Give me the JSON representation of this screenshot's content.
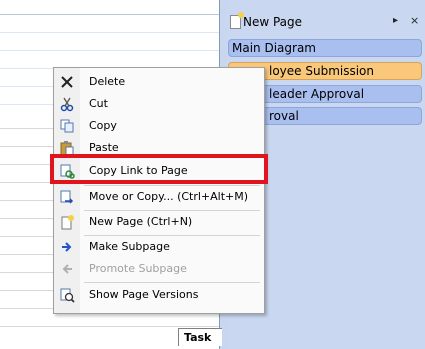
{
  "pages_pane": {
    "new_page_label": "New Page",
    "arrow_icon": "▸",
    "close_icon": "×",
    "tabs": [
      {
        "label": "Main Diagram",
        "active": false
      },
      {
        "label": "Employee Submission",
        "active": true,
        "visible_label": "loyee Submission"
      },
      {
        "label": "Team Leader Approval",
        "active": false,
        "visible_label": "leader Approval"
      },
      {
        "label": "Approval",
        "active": false,
        "visible_label": "roval"
      }
    ]
  },
  "canvas": {
    "task_header": "Task"
  },
  "context_menu": {
    "items": [
      {
        "label": "Delete",
        "icon": "x-icon",
        "enabled": true
      },
      {
        "label": "Cut",
        "icon": "scissors-icon",
        "enabled": true
      },
      {
        "label": "Copy",
        "icon": "copy-icon",
        "enabled": true
      },
      {
        "label": "Paste",
        "icon": "paste-icon",
        "enabled": true
      },
      {
        "label": "Copy Link to Page",
        "icon": "link-icon",
        "enabled": true,
        "highlighted": true
      },
      {
        "label": "Move or Copy...   (Ctrl+Alt+M)",
        "icon": "move-copy-icon",
        "enabled": true
      },
      {
        "label": "New Page  (Ctrl+N)",
        "icon": "new-page-icon",
        "enabled": true
      },
      {
        "label": "Make Subpage",
        "icon": "arrow-right-icon",
        "enabled": true
      },
      {
        "label": "Promote Subpage",
        "icon": "arrow-left-icon",
        "enabled": false
      },
      {
        "label": "Show Page Versions",
        "icon": "versions-icon",
        "enabled": true
      }
    ]
  },
  "colors": {
    "pane_bg": "#c9d8f0",
    "tab_bg": "#a9bff0",
    "tab_active_bg": "#f9c87a",
    "highlight_border": "#e0141e"
  }
}
